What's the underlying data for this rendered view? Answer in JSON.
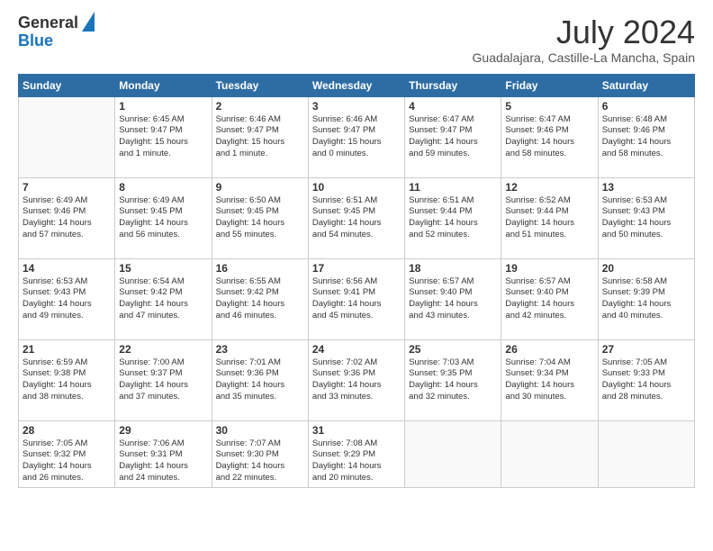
{
  "header": {
    "logo_line1": "General",
    "logo_line2": "Blue",
    "month": "July 2024",
    "location": "Guadalajara, Castille-La Mancha, Spain"
  },
  "days_of_week": [
    "Sunday",
    "Monday",
    "Tuesday",
    "Wednesday",
    "Thursday",
    "Friday",
    "Saturday"
  ],
  "weeks": [
    [
      {
        "day": "",
        "info": ""
      },
      {
        "day": "1",
        "info": "Sunrise: 6:45 AM\nSunset: 9:47 PM\nDaylight: 15 hours\nand 1 minute."
      },
      {
        "day": "2",
        "info": "Sunrise: 6:46 AM\nSunset: 9:47 PM\nDaylight: 15 hours\nand 1 minute."
      },
      {
        "day": "3",
        "info": "Sunrise: 6:46 AM\nSunset: 9:47 PM\nDaylight: 15 hours\nand 0 minutes."
      },
      {
        "day": "4",
        "info": "Sunrise: 6:47 AM\nSunset: 9:47 PM\nDaylight: 14 hours\nand 59 minutes."
      },
      {
        "day": "5",
        "info": "Sunrise: 6:47 AM\nSunset: 9:46 PM\nDaylight: 14 hours\nand 58 minutes."
      },
      {
        "day": "6",
        "info": "Sunrise: 6:48 AM\nSunset: 9:46 PM\nDaylight: 14 hours\nand 58 minutes."
      }
    ],
    [
      {
        "day": "7",
        "info": "Sunrise: 6:49 AM\nSunset: 9:46 PM\nDaylight: 14 hours\nand 57 minutes."
      },
      {
        "day": "8",
        "info": "Sunrise: 6:49 AM\nSunset: 9:45 PM\nDaylight: 14 hours\nand 56 minutes."
      },
      {
        "day": "9",
        "info": "Sunrise: 6:50 AM\nSunset: 9:45 PM\nDaylight: 14 hours\nand 55 minutes."
      },
      {
        "day": "10",
        "info": "Sunrise: 6:51 AM\nSunset: 9:45 PM\nDaylight: 14 hours\nand 54 minutes."
      },
      {
        "day": "11",
        "info": "Sunrise: 6:51 AM\nSunset: 9:44 PM\nDaylight: 14 hours\nand 52 minutes."
      },
      {
        "day": "12",
        "info": "Sunrise: 6:52 AM\nSunset: 9:44 PM\nDaylight: 14 hours\nand 51 minutes."
      },
      {
        "day": "13",
        "info": "Sunrise: 6:53 AM\nSunset: 9:43 PM\nDaylight: 14 hours\nand 50 minutes."
      }
    ],
    [
      {
        "day": "14",
        "info": "Sunrise: 6:53 AM\nSunset: 9:43 PM\nDaylight: 14 hours\nand 49 minutes."
      },
      {
        "day": "15",
        "info": "Sunrise: 6:54 AM\nSunset: 9:42 PM\nDaylight: 14 hours\nand 47 minutes."
      },
      {
        "day": "16",
        "info": "Sunrise: 6:55 AM\nSunset: 9:42 PM\nDaylight: 14 hours\nand 46 minutes."
      },
      {
        "day": "17",
        "info": "Sunrise: 6:56 AM\nSunset: 9:41 PM\nDaylight: 14 hours\nand 45 minutes."
      },
      {
        "day": "18",
        "info": "Sunrise: 6:57 AM\nSunset: 9:40 PM\nDaylight: 14 hours\nand 43 minutes."
      },
      {
        "day": "19",
        "info": "Sunrise: 6:57 AM\nSunset: 9:40 PM\nDaylight: 14 hours\nand 42 minutes."
      },
      {
        "day": "20",
        "info": "Sunrise: 6:58 AM\nSunset: 9:39 PM\nDaylight: 14 hours\nand 40 minutes."
      }
    ],
    [
      {
        "day": "21",
        "info": "Sunrise: 6:59 AM\nSunset: 9:38 PM\nDaylight: 14 hours\nand 38 minutes."
      },
      {
        "day": "22",
        "info": "Sunrise: 7:00 AM\nSunset: 9:37 PM\nDaylight: 14 hours\nand 37 minutes."
      },
      {
        "day": "23",
        "info": "Sunrise: 7:01 AM\nSunset: 9:36 PM\nDaylight: 14 hours\nand 35 minutes."
      },
      {
        "day": "24",
        "info": "Sunrise: 7:02 AM\nSunset: 9:36 PM\nDaylight: 14 hours\nand 33 minutes."
      },
      {
        "day": "25",
        "info": "Sunrise: 7:03 AM\nSunset: 9:35 PM\nDaylight: 14 hours\nand 32 minutes."
      },
      {
        "day": "26",
        "info": "Sunrise: 7:04 AM\nSunset: 9:34 PM\nDaylight: 14 hours\nand 30 minutes."
      },
      {
        "day": "27",
        "info": "Sunrise: 7:05 AM\nSunset: 9:33 PM\nDaylight: 14 hours\nand 28 minutes."
      }
    ],
    [
      {
        "day": "28",
        "info": "Sunrise: 7:05 AM\nSunset: 9:32 PM\nDaylight: 14 hours\nand 26 minutes."
      },
      {
        "day": "29",
        "info": "Sunrise: 7:06 AM\nSunset: 9:31 PM\nDaylight: 14 hours\nand 24 minutes."
      },
      {
        "day": "30",
        "info": "Sunrise: 7:07 AM\nSunset: 9:30 PM\nDaylight: 14 hours\nand 22 minutes."
      },
      {
        "day": "31",
        "info": "Sunrise: 7:08 AM\nSunset: 9:29 PM\nDaylight: 14 hours\nand 20 minutes."
      },
      {
        "day": "",
        "info": ""
      },
      {
        "day": "",
        "info": ""
      },
      {
        "day": "",
        "info": ""
      }
    ]
  ]
}
